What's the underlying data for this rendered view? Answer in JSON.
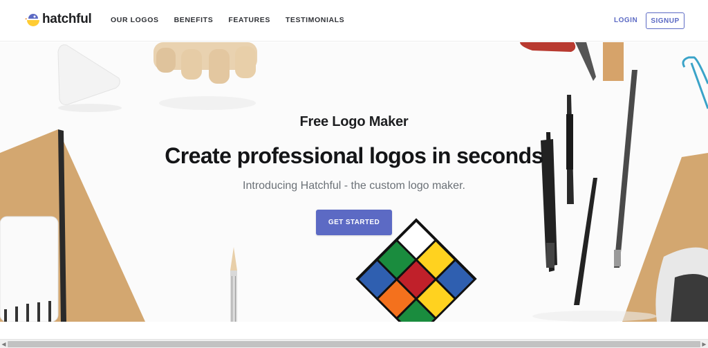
{
  "header": {
    "brand": "hatchful",
    "nav": [
      "OUR LOGOS",
      "BENEFITS",
      "FEATURES",
      "TESTIMONIALS"
    ],
    "login_label": "LOGIN",
    "signup_label": "SIGNUP"
  },
  "hero": {
    "subtitle": "Free Logo Maker",
    "title": "Create professional logos in seconds",
    "lead": "Introducing Hatchful - the custom logo maker.",
    "cta_label": "GET STARTED"
  },
  "colors": {
    "accent": "#5c6ac4",
    "logo_yellow": "#ffcc33",
    "logo_purple": "#5c6ac4",
    "background": "#fbfbfb"
  },
  "icons": {
    "logo": "hatchful-chick-icon",
    "scroll_left": "scroll-left-arrow-icon",
    "scroll_right": "scroll-right-arrow-icon"
  }
}
